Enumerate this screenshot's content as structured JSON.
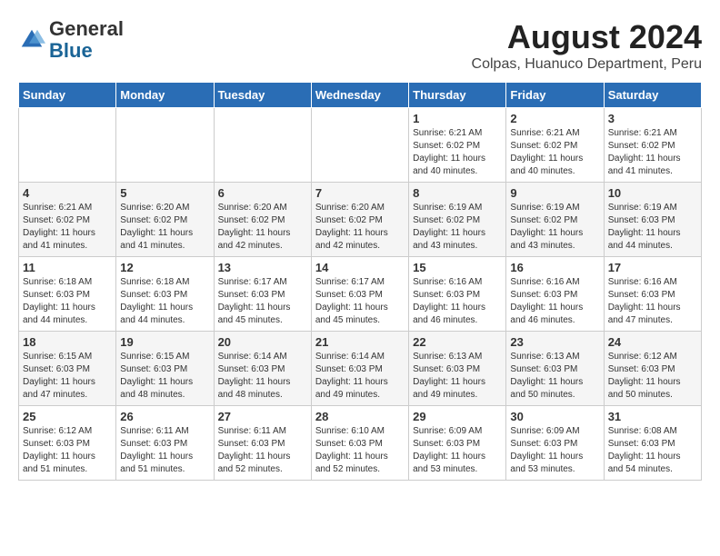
{
  "header": {
    "logo_line1": "General",
    "logo_line2": "Blue",
    "title": "August 2024",
    "subtitle": "Colpas, Huanuco Department, Peru"
  },
  "days_of_week": [
    "Sunday",
    "Monday",
    "Tuesday",
    "Wednesday",
    "Thursday",
    "Friday",
    "Saturday"
  ],
  "weeks": [
    [
      {
        "day": "",
        "info": ""
      },
      {
        "day": "",
        "info": ""
      },
      {
        "day": "",
        "info": ""
      },
      {
        "day": "",
        "info": ""
      },
      {
        "day": "1",
        "info": "Sunrise: 6:21 AM\nSunset: 6:02 PM\nDaylight: 11 hours\nand 40 minutes."
      },
      {
        "day": "2",
        "info": "Sunrise: 6:21 AM\nSunset: 6:02 PM\nDaylight: 11 hours\nand 40 minutes."
      },
      {
        "day": "3",
        "info": "Sunrise: 6:21 AM\nSunset: 6:02 PM\nDaylight: 11 hours\nand 41 minutes."
      }
    ],
    [
      {
        "day": "4",
        "info": "Sunrise: 6:21 AM\nSunset: 6:02 PM\nDaylight: 11 hours\nand 41 minutes."
      },
      {
        "day": "5",
        "info": "Sunrise: 6:20 AM\nSunset: 6:02 PM\nDaylight: 11 hours\nand 41 minutes."
      },
      {
        "day": "6",
        "info": "Sunrise: 6:20 AM\nSunset: 6:02 PM\nDaylight: 11 hours\nand 42 minutes."
      },
      {
        "day": "7",
        "info": "Sunrise: 6:20 AM\nSunset: 6:02 PM\nDaylight: 11 hours\nand 42 minutes."
      },
      {
        "day": "8",
        "info": "Sunrise: 6:19 AM\nSunset: 6:02 PM\nDaylight: 11 hours\nand 43 minutes."
      },
      {
        "day": "9",
        "info": "Sunrise: 6:19 AM\nSunset: 6:02 PM\nDaylight: 11 hours\nand 43 minutes."
      },
      {
        "day": "10",
        "info": "Sunrise: 6:19 AM\nSunset: 6:03 PM\nDaylight: 11 hours\nand 44 minutes."
      }
    ],
    [
      {
        "day": "11",
        "info": "Sunrise: 6:18 AM\nSunset: 6:03 PM\nDaylight: 11 hours\nand 44 minutes."
      },
      {
        "day": "12",
        "info": "Sunrise: 6:18 AM\nSunset: 6:03 PM\nDaylight: 11 hours\nand 44 minutes."
      },
      {
        "day": "13",
        "info": "Sunrise: 6:17 AM\nSunset: 6:03 PM\nDaylight: 11 hours\nand 45 minutes."
      },
      {
        "day": "14",
        "info": "Sunrise: 6:17 AM\nSunset: 6:03 PM\nDaylight: 11 hours\nand 45 minutes."
      },
      {
        "day": "15",
        "info": "Sunrise: 6:16 AM\nSunset: 6:03 PM\nDaylight: 11 hours\nand 46 minutes."
      },
      {
        "day": "16",
        "info": "Sunrise: 6:16 AM\nSunset: 6:03 PM\nDaylight: 11 hours\nand 46 minutes."
      },
      {
        "day": "17",
        "info": "Sunrise: 6:16 AM\nSunset: 6:03 PM\nDaylight: 11 hours\nand 47 minutes."
      }
    ],
    [
      {
        "day": "18",
        "info": "Sunrise: 6:15 AM\nSunset: 6:03 PM\nDaylight: 11 hours\nand 47 minutes."
      },
      {
        "day": "19",
        "info": "Sunrise: 6:15 AM\nSunset: 6:03 PM\nDaylight: 11 hours\nand 48 minutes."
      },
      {
        "day": "20",
        "info": "Sunrise: 6:14 AM\nSunset: 6:03 PM\nDaylight: 11 hours\nand 48 minutes."
      },
      {
        "day": "21",
        "info": "Sunrise: 6:14 AM\nSunset: 6:03 PM\nDaylight: 11 hours\nand 49 minutes."
      },
      {
        "day": "22",
        "info": "Sunrise: 6:13 AM\nSunset: 6:03 PM\nDaylight: 11 hours\nand 49 minutes."
      },
      {
        "day": "23",
        "info": "Sunrise: 6:13 AM\nSunset: 6:03 PM\nDaylight: 11 hours\nand 50 minutes."
      },
      {
        "day": "24",
        "info": "Sunrise: 6:12 AM\nSunset: 6:03 PM\nDaylight: 11 hours\nand 50 minutes."
      }
    ],
    [
      {
        "day": "25",
        "info": "Sunrise: 6:12 AM\nSunset: 6:03 PM\nDaylight: 11 hours\nand 51 minutes."
      },
      {
        "day": "26",
        "info": "Sunrise: 6:11 AM\nSunset: 6:03 PM\nDaylight: 11 hours\nand 51 minutes."
      },
      {
        "day": "27",
        "info": "Sunrise: 6:11 AM\nSunset: 6:03 PM\nDaylight: 11 hours\nand 52 minutes."
      },
      {
        "day": "28",
        "info": "Sunrise: 6:10 AM\nSunset: 6:03 PM\nDaylight: 11 hours\nand 52 minutes."
      },
      {
        "day": "29",
        "info": "Sunrise: 6:09 AM\nSunset: 6:03 PM\nDaylight: 11 hours\nand 53 minutes."
      },
      {
        "day": "30",
        "info": "Sunrise: 6:09 AM\nSunset: 6:03 PM\nDaylight: 11 hours\nand 53 minutes."
      },
      {
        "day": "31",
        "info": "Sunrise: 6:08 AM\nSunset: 6:03 PM\nDaylight: 11 hours\nand 54 minutes."
      }
    ]
  ]
}
